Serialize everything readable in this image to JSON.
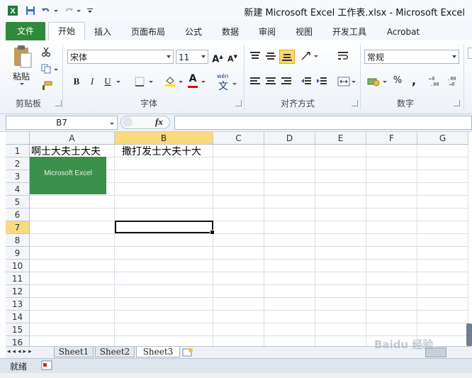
{
  "title_bar": {
    "title": "新建 Microsoft Excel 工作表.xlsx - Microsoft Excel",
    "app_icon": "excel-logo-icon",
    "qat": [
      "save-icon",
      "undo-icon",
      "redo-icon",
      "customize-qat-icon"
    ]
  },
  "ribbon_tabs": [
    "文件",
    "开始",
    "插入",
    "页面布局",
    "公式",
    "数据",
    "审阅",
    "视图",
    "开发工具",
    "Acrobat"
  ],
  "active_tab": "开始",
  "ribbon": {
    "clipboard": {
      "label": "剪贴板",
      "paste": "粘贴"
    },
    "font": {
      "label": "字体",
      "font_name": "宋体",
      "font_size": "11",
      "wen": "wén",
      "wen_char": "文"
    },
    "alignment": {
      "label": "对齐方式"
    },
    "number": {
      "label": "数字",
      "format": "常规",
      "percent": "%"
    }
  },
  "formula_bar": {
    "name_box": "B7",
    "fx": "fx",
    "formula": ""
  },
  "grid": {
    "columns": [
      "A",
      "B",
      "C",
      "D",
      "E",
      "F",
      "G"
    ],
    "selected_column": "B",
    "rows": [
      "1",
      "2",
      "3",
      "4",
      "5",
      "6",
      "7",
      "8",
      "9",
      "10",
      "11",
      "12",
      "13",
      "14",
      "15",
      "16"
    ],
    "selected_row": "7",
    "active_cell": "B7",
    "cells": {
      "A1": "啊士大夫士大夫",
      "B1": "撒打发士大夫十大"
    },
    "embedded_image": {
      "text": "Microsoft Excel",
      "color": "#3a8f4a"
    }
  },
  "sheets": [
    "Sheet1",
    "Sheet2",
    "Sheet3"
  ],
  "active_sheet": "Sheet3",
  "status": {
    "ready": "就绪"
  },
  "watermark": {
    "text": "Baidu 经验"
  },
  "colors": {
    "file_tab": "#2f8a3c",
    "selection_header": "#f9da7e",
    "ribbon_bg": "#edf2f8"
  }
}
